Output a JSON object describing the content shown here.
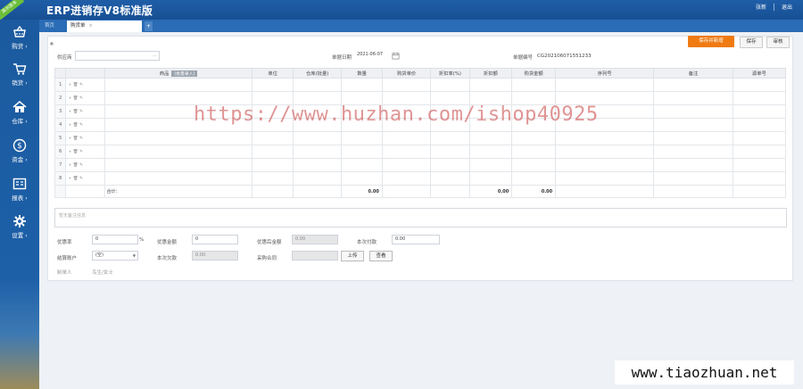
{
  "app": {
    "title": "ERP进销存V8标准版",
    "badge": "演示版本"
  },
  "top_links": [
    "张新",
    "退出"
  ],
  "sidebar": [
    {
      "label": "购货",
      "icon": "basket-icon"
    },
    {
      "label": "销货",
      "icon": "cart-icon"
    },
    {
      "label": "仓库",
      "icon": "house-icon"
    },
    {
      "label": "资金",
      "icon": "dollar-icon"
    },
    {
      "label": "报表",
      "icon": "report-icon"
    },
    {
      "label": "设置",
      "icon": "gear-icon"
    }
  ],
  "tabs": {
    "home": "首页",
    "active": "购货单",
    "close": "×",
    "add": "+"
  },
  "toolbar": {
    "save_new": "保存并新增",
    "save": "保存",
    "audit": "审核"
  },
  "form": {
    "supplier_label": "供应商",
    "supplier_value": "",
    "date_label": "单据日期",
    "date_value": "2021-06-07",
    "number_label": "单据编号",
    "number_value": "CG202106071551233"
  },
  "table": {
    "columns": [
      "",
      "",
      "商品",
      "单位",
      "仓库(批量)",
      "数量",
      "购货单价",
      "折扣率(%)",
      "折扣额",
      "购货金额",
      "序列号",
      "备注",
      "源单号"
    ],
    "search_tag": "(批量录入)",
    "ops": "+ 🗑 ✎",
    "rows": [
      "1",
      "2",
      "3",
      "4",
      "5",
      "6",
      "7",
      "8"
    ],
    "total_label": "合计：",
    "totals": {
      "quantity": "0.00",
      "discount": "0.00",
      "amount": "0.00"
    }
  },
  "remark_placeholder": "暂无备注信息",
  "footer": {
    "discount_rate_label": "优惠率",
    "discount_rate_value": "0",
    "percent": "%",
    "discount_amount_label": "优惠金额",
    "discount_amount_value": "0",
    "after_discount_label": "优惠后金额",
    "after_discount_value": "0.00",
    "payment_label": "本次付款",
    "payment_value": "0.00",
    "account_label": "结算账户",
    "account_value": "(空)",
    "arrears_label": "本次欠款",
    "arrears_value": "0.00",
    "contract_label": "采购合同",
    "upload": "上传",
    "view": "查看",
    "maker_label": "制单人",
    "maker_value": "鸟生/女士"
  },
  "watermark": "https://www.huzhan.com/ishop40925",
  "watermark2": "www.tiaozhuan.net"
}
